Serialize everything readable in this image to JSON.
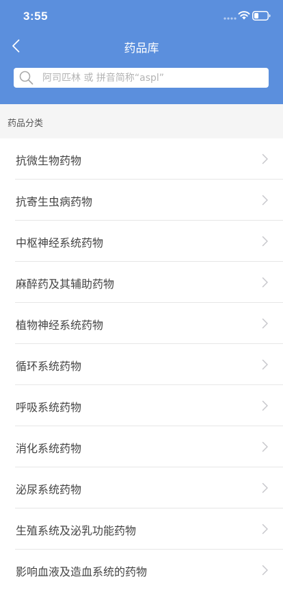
{
  "status_bar": {
    "time": "3:55"
  },
  "nav": {
    "title": "药品库",
    "back_icon": "chevron-left-icon"
  },
  "search": {
    "placeholder": "阿司匹林 或 拼音简称“aspl”",
    "value": "",
    "icon": "search-icon"
  },
  "section": {
    "title": "药品分类"
  },
  "categories": [
    {
      "label": "抗微生物药物"
    },
    {
      "label": "抗寄生虫病药物"
    },
    {
      "label": "中枢神经系统药物"
    },
    {
      "label": "麻醉药及其辅助药物"
    },
    {
      "label": "植物神经系统药物"
    },
    {
      "label": "循环系统药物"
    },
    {
      "label": "呼吸系统药物"
    },
    {
      "label": "消化系统药物"
    },
    {
      "label": "泌尿系统药物"
    },
    {
      "label": "生殖系统及泌乳功能药物"
    },
    {
      "label": "影响血液及造血系统的药物"
    }
  ],
  "colors": {
    "header_bg": "#5b8fdd",
    "section_bg": "#f5f5f5",
    "divider": "#e6e6e6",
    "chevron": "#c7c7cc"
  }
}
